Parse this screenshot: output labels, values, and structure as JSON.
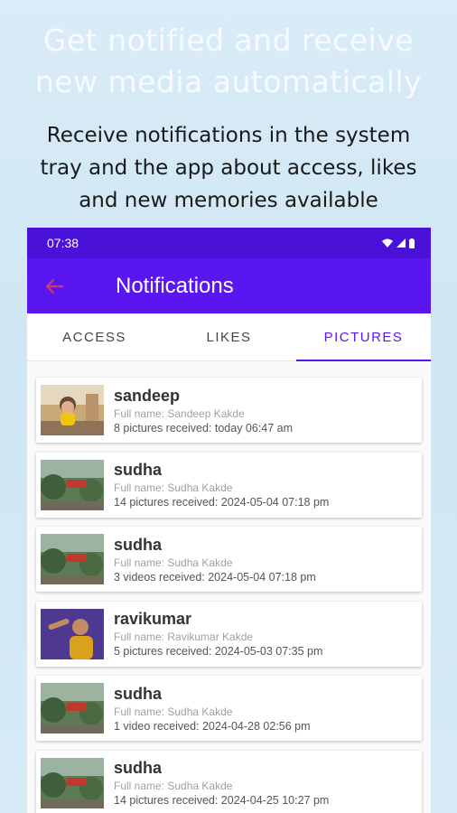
{
  "promo": {
    "headline_line1": "Get notified and receive",
    "headline_line2": "new media automatically",
    "sub_line1": "Receive notifications in the system",
    "sub_line2": "tray and the app about access, likes",
    "sub_line3": "and new memories available"
  },
  "status_bar": {
    "time": "07:38",
    "icons": [
      "wifi-icon",
      "signal-icon",
      "battery-icon"
    ]
  },
  "app_bar": {
    "title": "Notifications",
    "back_icon": "arrow-left-icon"
  },
  "tabs": [
    {
      "label": "ACCESS",
      "active": false
    },
    {
      "label": "LIKES",
      "active": false
    },
    {
      "label": "PICTURES",
      "active": true
    }
  ],
  "colors": {
    "accent": "#5a16f0",
    "status_bar": "#4a11d8"
  },
  "notifications": [
    {
      "username": "sandeep",
      "full_name": "Full name: Sandeep Kakde",
      "received": "8 pictures received: today 06:47 am",
      "thumb": "child-photo"
    },
    {
      "username": "sudha",
      "full_name": "Full name: Sudha Kakde",
      "received": "14 pictures received: 2024-05-04 07:18 pm",
      "thumb": "garden-photo"
    },
    {
      "username": "sudha",
      "full_name": "Full name: Sudha Kakde",
      "received": "3 videos received: 2024-05-04 07:18 pm",
      "thumb": "garden-photo"
    },
    {
      "username": "ravikumar",
      "full_name": "Full name: Ravikumar Kakde",
      "received": "5 pictures received: 2024-05-03 07:35 pm",
      "thumb": "person-photo"
    },
    {
      "username": "sudha",
      "full_name": "Full name: Sudha Kakde",
      "received": "1 video received: 2024-04-28 02:56 pm",
      "thumb": "garden-photo"
    },
    {
      "username": "sudha",
      "full_name": "Full name: Sudha Kakde",
      "received": "14 pictures received: 2024-04-25 10:27 pm",
      "thumb": "garden-photo"
    }
  ]
}
